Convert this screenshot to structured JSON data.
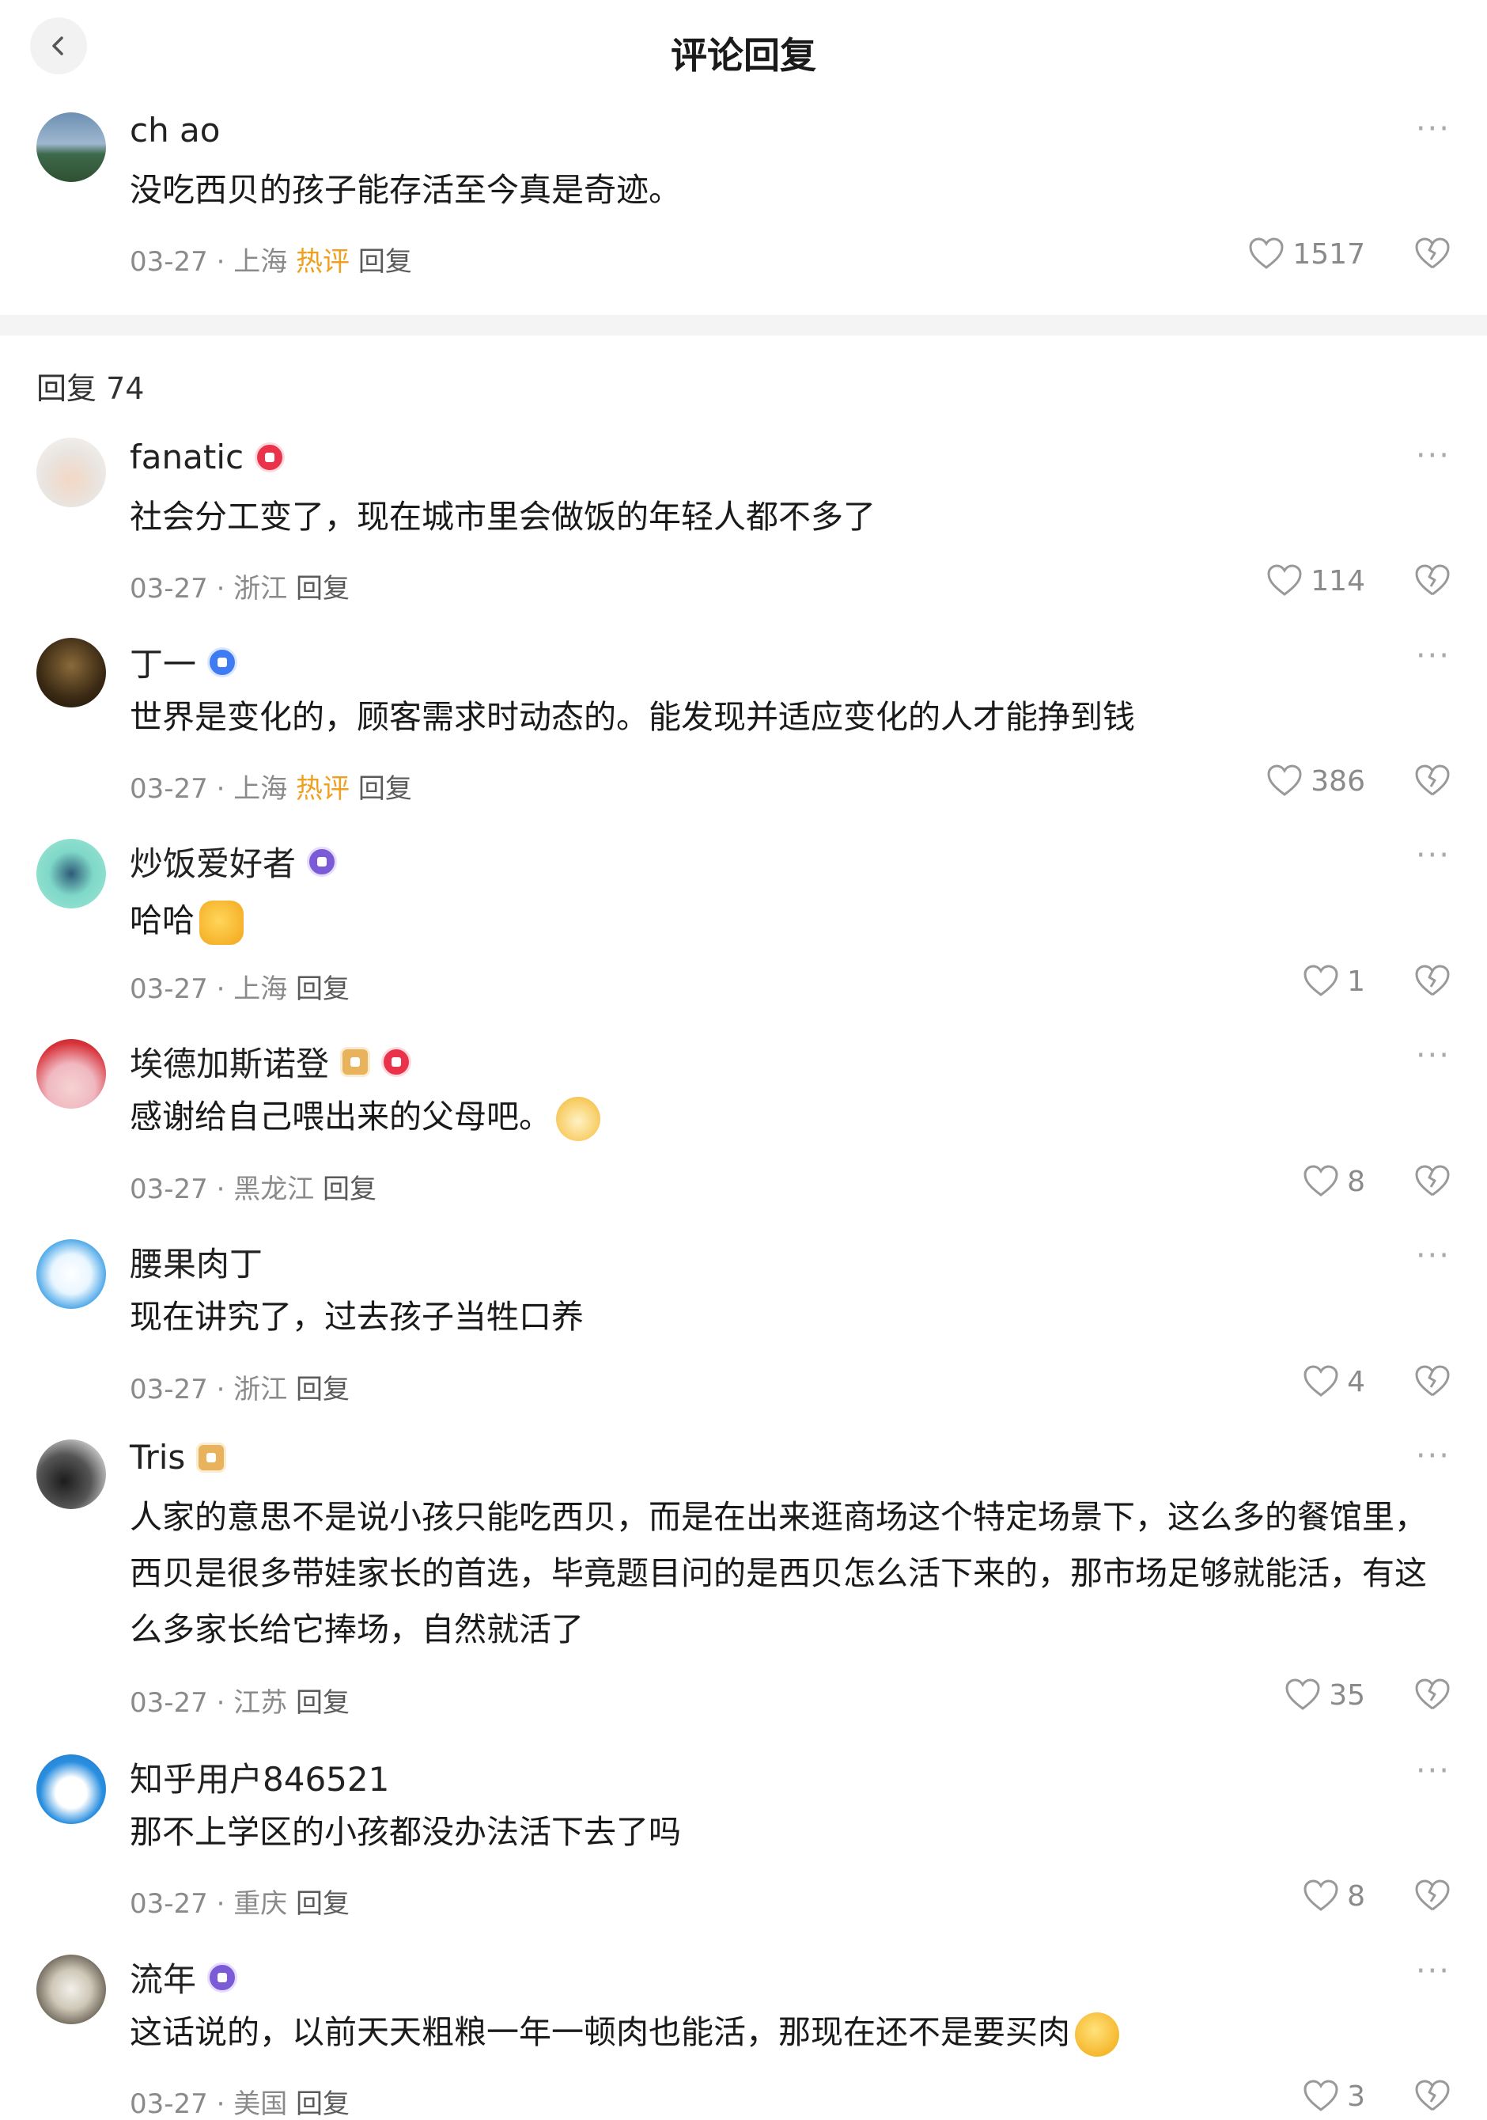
{
  "header": {
    "title": "评论回复"
  },
  "main_comment": {
    "username": "ch ao",
    "text": "没吃西贝的孩子能存活至今真是奇迹。",
    "date": "03-27",
    "sep": "·",
    "location": "上海",
    "hot": "热评",
    "reply": "回复",
    "likes": "1517"
  },
  "replies_header": "回复 74",
  "replies": [
    {
      "username": "fanatic",
      "text": "社会分工变了，现在城市里会做饭的年轻人都不多了",
      "date": "03-27",
      "sep": "·",
      "location": "浙江",
      "reply": "回复",
      "likes": "114"
    },
    {
      "username": "丁一",
      "text": "世界是变化的，顾客需求时动态的。能发现并适应变化的人才能挣到钱",
      "date": "03-27",
      "sep": "·",
      "location": "上海",
      "hot": "热评",
      "reply": "回复",
      "likes": "386"
    },
    {
      "username": "炒饭爱好者",
      "text": "哈哈",
      "date": "03-27",
      "sep": "·",
      "location": "上海",
      "reply": "回复",
      "likes": "1"
    },
    {
      "username": "埃德加斯诺登",
      "text": "感谢给自己喂出来的父母吧。",
      "date": "03-27",
      "sep": "·",
      "location": "黑龙江",
      "reply": "回复",
      "likes": "8"
    },
    {
      "username": "腰果肉丁",
      "text": "现在讲究了，过去孩子当牲口养",
      "date": "03-27",
      "sep": "·",
      "location": "浙江",
      "reply": "回复",
      "likes": "4"
    },
    {
      "username": "Tris",
      "text": "人家的意思不是说小孩只能吃西贝，而是在出来逛商场这个特定场景下，这么多的餐馆里，西贝是很多带娃家长的首选，毕竟题目问的是西贝怎么活下来的，那市场足够就能活，有这么多家长给它捧场，自然就活了",
      "date": "03-27",
      "sep": "·",
      "location": "江苏",
      "reply": "回复",
      "likes": "35"
    },
    {
      "username": "知乎用户846521",
      "text": "那不上学区的小孩都没办法活下去了吗",
      "date": "03-27",
      "sep": "·",
      "location": "重庆",
      "reply": "回复",
      "likes": "8"
    },
    {
      "username": "流年",
      "text": "这话说的，以前天天粗粮一年一顿肉也能活，那现在还不是要买肉",
      "date": "03-27",
      "sep": "·",
      "location": "美国",
      "reply": "回复",
      "likes": "3"
    }
  ],
  "icons": {
    "more": "more-dots-icon",
    "like": "heart-icon",
    "dislike": "broken-heart-icon",
    "back": "chevron-left-icon"
  },
  "colors": {
    "hot": "#f0a020",
    "meta": "#8a8a8a",
    "divider": "#f4f4f4"
  }
}
